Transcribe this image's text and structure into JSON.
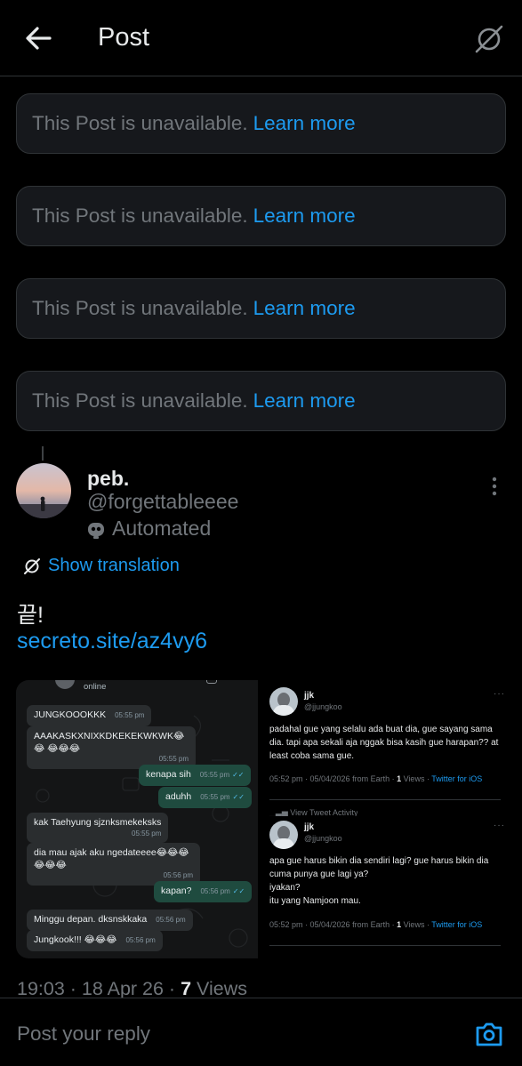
{
  "header": {
    "title": "Post"
  },
  "unavailable_posts": [
    {
      "text": "This Post is unavailable.",
      "link": "Learn more"
    },
    {
      "text": "This Post is unavailable.",
      "link": "Learn more"
    },
    {
      "text": "This Post is unavailable.",
      "link": "Learn more"
    },
    {
      "text": "This Post is unavailable.",
      "link": "Learn more"
    }
  ],
  "post": {
    "name": "peb.",
    "handle": "@forgettableeee",
    "label": "Automated",
    "show_translation": "Show translation",
    "text": "끝!",
    "link": "secreto.site/az4vy6",
    "time": "19:03 · 18 Apr 26 · ",
    "views_count": "7",
    "views_label": " Views"
  },
  "media": {
    "chat": {
      "status": "online",
      "messages": [
        {
          "text": "JUNGKOOOKKK",
          "time": "05:55 pm"
        },
        {
          "text": "AAAKASKXNIXKDKEKEKWKWK😂😂 😂😂😂",
          "time": "05:55 pm"
        },
        {
          "text": "kenapa sih",
          "time": "05:55 pm"
        },
        {
          "text": "aduhh",
          "time": "05:55 pm"
        },
        {
          "text": "kak Taehyung sjznksmekeksks",
          "time": "05:55 pm"
        },
        {
          "text": "dia mau ajak aku ngedateeee😂😂😂 😂😂😂",
          "time": "05:56 pm"
        },
        {
          "text": "kapan?",
          "time": "05:56 pm"
        },
        {
          "text": "Minggu depan. dksnskkaka",
          "time": "05:56 pm"
        },
        {
          "text": "Jungkook!!! 😂😂😂",
          "time": "05:56 pm"
        }
      ]
    },
    "tweets": [
      {
        "name": "jjk",
        "handle": "@jjungkoo",
        "text": "padahal gue yang selalu ada buat dia, gue sayang sama dia. tapi apa sekali aja nggak bisa kasih gue harapan?? at least coba sama gue.",
        "meta": "05:52 pm · 05/04/2026 from Earth · ",
        "views_count": "1",
        "views_label": " Views · ",
        "client": "Twitter for iOS",
        "activity": "View Tweet Activity"
      },
      {
        "name": "jjk",
        "handle": "@jjungkoo",
        "text": "apa gue harus bikin dia sendiri lagi? gue harus bikin dia cuma punya gue lagi ya?\niyakan?\nitu yang Namjoon mau.",
        "meta": "05:52 pm · 05/04/2026 from Earth · ",
        "views_count": "1",
        "views_label": " Views · ",
        "client": "Twitter for iOS"
      }
    ]
  },
  "reply": {
    "placeholder": "Post your reply"
  },
  "colors": {
    "accent": "#1d9bf0",
    "muted": "#71767b",
    "card": "#16181c",
    "border": "#2f3336"
  }
}
